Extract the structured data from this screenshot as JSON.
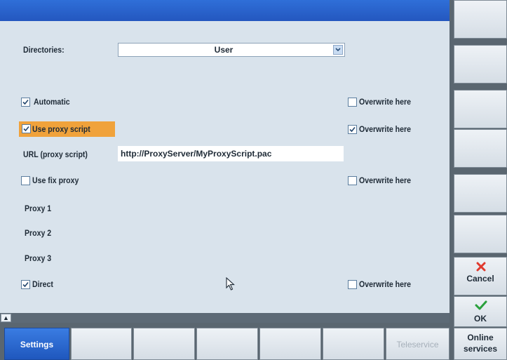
{
  "form": {
    "directories_label": "Directories:",
    "directories_value": "User",
    "automatic_label": "Automatic",
    "automatic_checked": true,
    "use_proxy_script_label": "Use proxy script",
    "use_proxy_script_checked": true,
    "url_label": "URL (proxy script)",
    "url_value": "http://ProxyServer/MyProxyScript.pac",
    "use_fix_proxy_label": "Use fix proxy",
    "use_fix_proxy_checked": false,
    "proxy1_label": "Proxy 1",
    "proxy2_label": "Proxy 2",
    "proxy3_label": "Proxy 3",
    "direct_label": "Direct",
    "direct_checked": true,
    "overwrite_label": "Overwrite here",
    "overwrite_automatic_checked": false,
    "overwrite_proxy_script_checked": true,
    "overwrite_fix_proxy_checked": false,
    "overwrite_direct_checked": false
  },
  "softkeys_right": {
    "cancel_label": "Cancel",
    "ok_label": "OK",
    "online_services_line1": "Online",
    "online_services_line2": "services"
  },
  "softkeys_bottom": {
    "settings_label": "Settings",
    "teleservice_label": "Teleservice"
  },
  "icons": {
    "check": "check-mark",
    "cancel": "red-x",
    "ok": "green-check",
    "combo_arrow": "chevron-down",
    "scroll_up": "triangle-up",
    "cursor": "mouse-pointer"
  },
  "colors": {
    "title_bar": "#2457bf",
    "highlight": "#f0a23b",
    "cancel_icon": "#e03a2e",
    "ok_icon": "#2aa13c",
    "active_softkey": "#2c6ad2"
  }
}
